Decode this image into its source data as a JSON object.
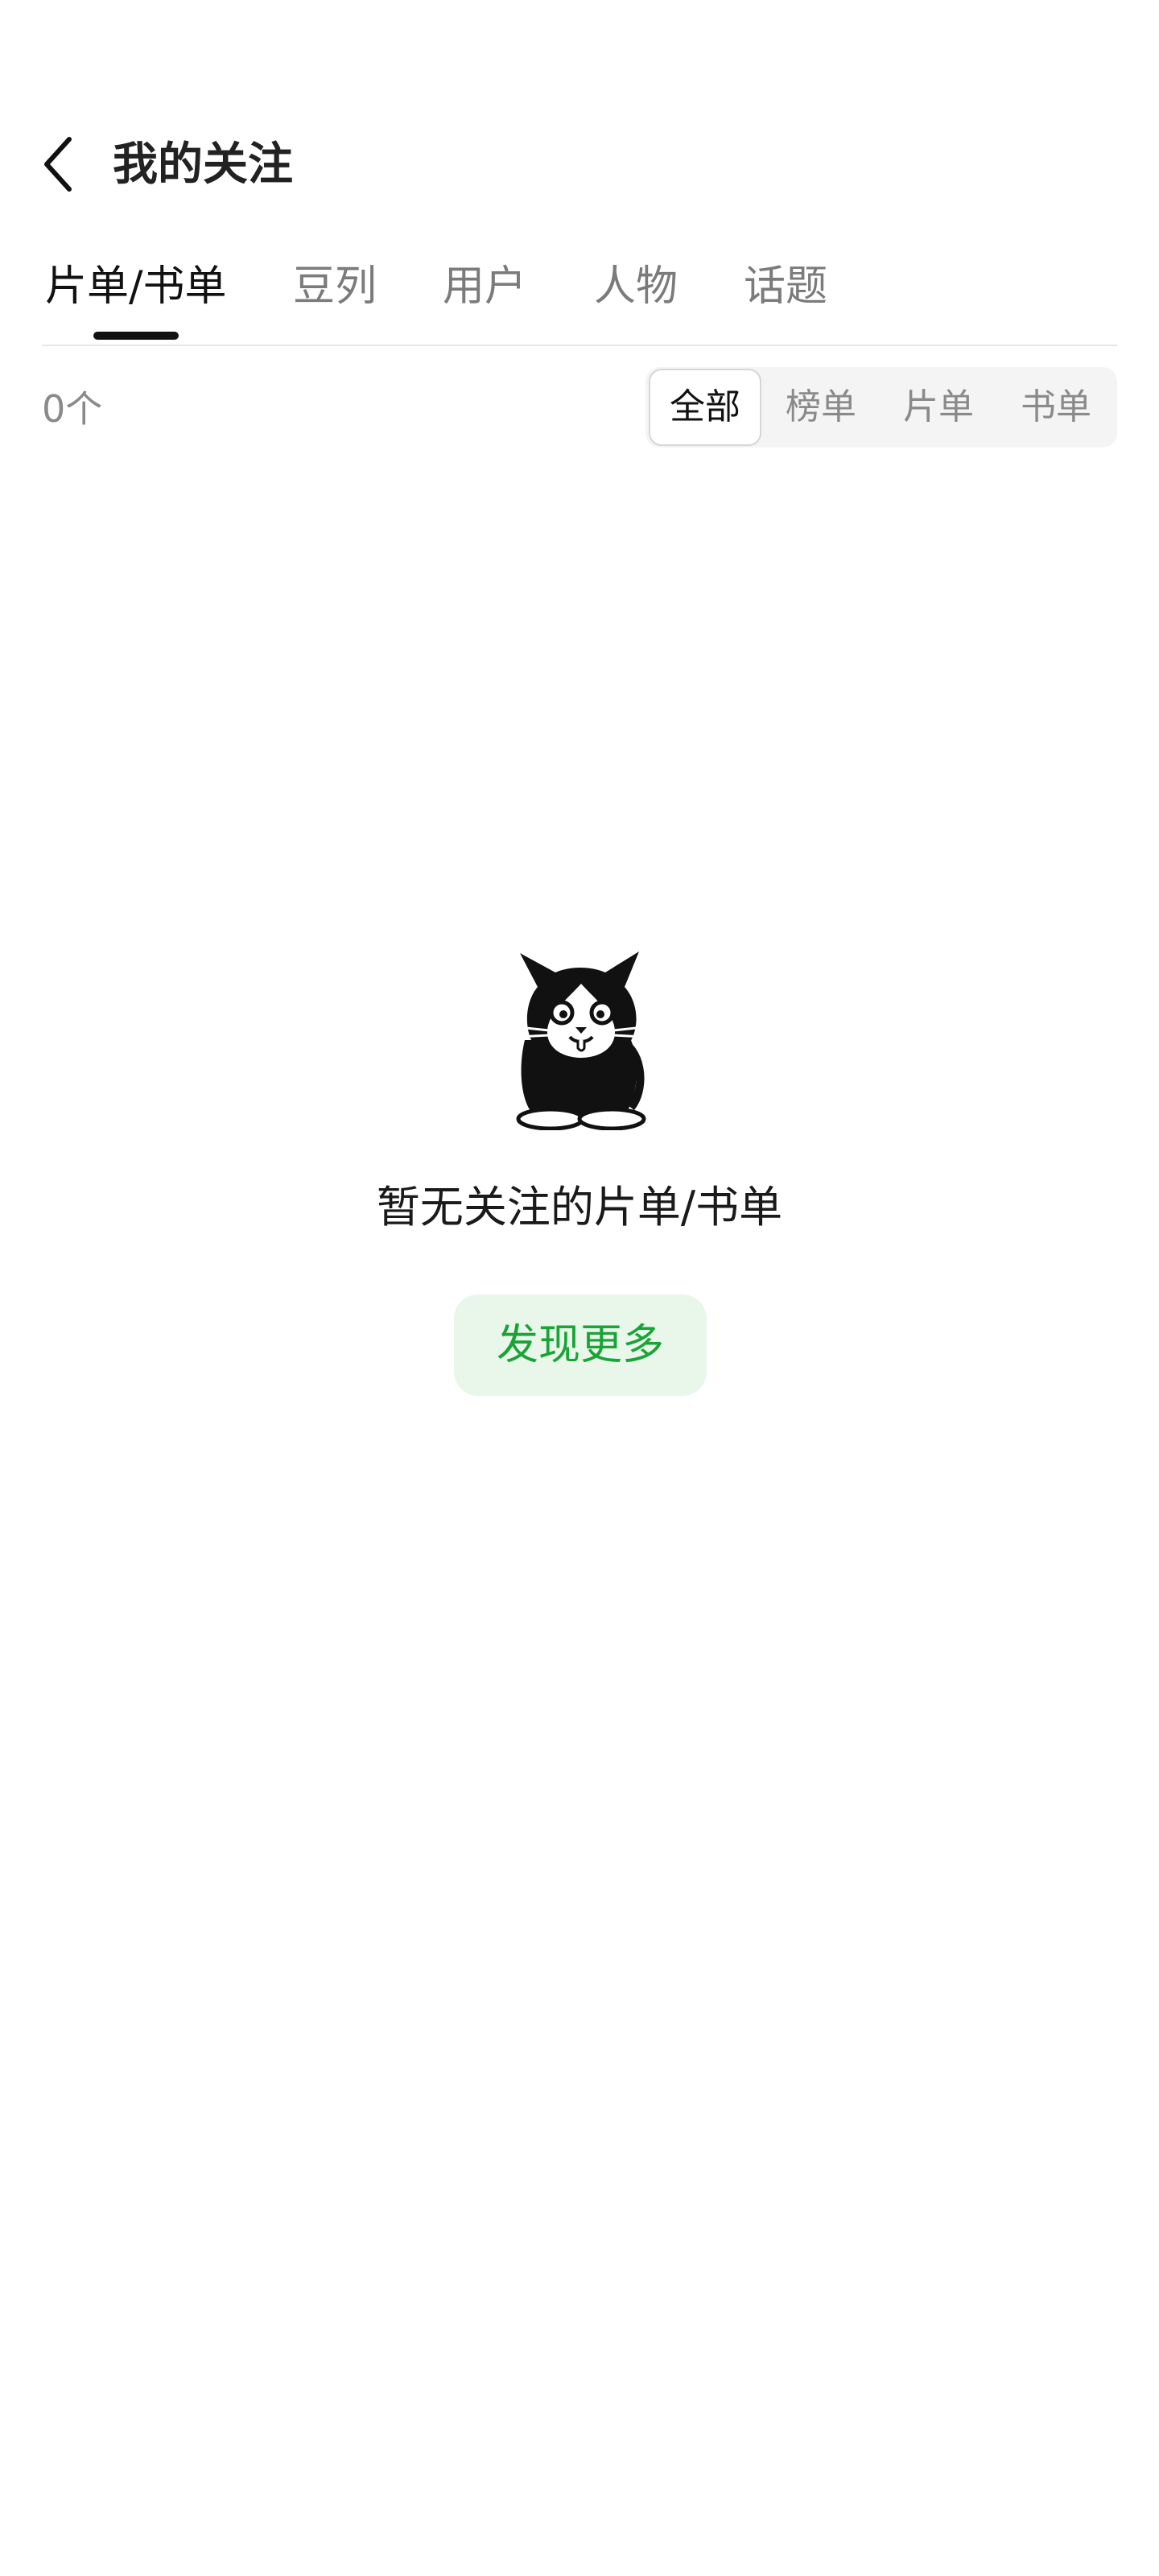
{
  "header": {
    "title": "我的关注",
    "back_icon": "chevron-left-icon"
  },
  "tabs": [
    {
      "label": "片单/书单",
      "active": true
    },
    {
      "label": "豆列",
      "active": false
    },
    {
      "label": "用户",
      "active": false
    },
    {
      "label": "人物",
      "active": false
    },
    {
      "label": "话题",
      "active": false
    }
  ],
  "filter": {
    "count": "0个",
    "options": [
      {
        "label": "全部",
        "active": true
      },
      {
        "label": "榜单",
        "active": false
      },
      {
        "label": "片单",
        "active": false
      },
      {
        "label": "书单",
        "active": false
      }
    ]
  },
  "empty_state": {
    "illustration": "cat-mascot-icon",
    "message": "暂无关注的片单/书单",
    "button_label": "发现更多"
  },
  "colors": {
    "accent_green": "#1aa336",
    "button_bg": "#e8f7ea",
    "active_text": "#111111",
    "inactive_text": "#7b7b7b"
  }
}
